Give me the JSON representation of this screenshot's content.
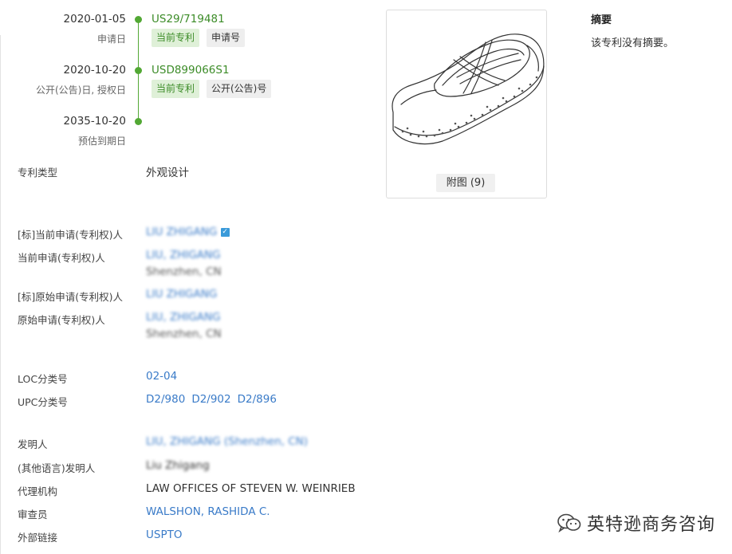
{
  "timeline": [
    {
      "date": "2020-01-05",
      "label": "申请日",
      "number": "US29/719481",
      "tags": [
        "当前专利",
        "申请号"
      ]
    },
    {
      "date": "2020-10-20",
      "label": "公开(公告)日, 授权日",
      "number": "USD899066S1",
      "tags": [
        "当前专利",
        "公开(公告)号"
      ]
    },
    {
      "date": "2035-10-20",
      "label": "预估到期日"
    }
  ],
  "figure": {
    "button_label": "附图 (9)"
  },
  "abstract": {
    "title": "摘要",
    "text": "该专利没有摘要。"
  },
  "fields": {
    "patent_type": {
      "label": "专利类型",
      "value": "外观设计"
    },
    "std_current_applicant": {
      "label": "[标]当前申请(专利权)人",
      "value": "LIU ZHIGANG"
    },
    "current_applicant": {
      "label": "当前申请(专利权)人",
      "value": "LIU, ZHIGANG",
      "location": "Shenzhen, CN"
    },
    "std_original_applicant": {
      "label": "[标]原始申请(专利权)人",
      "value": "LIU ZHIGANG"
    },
    "original_applicant": {
      "label": "原始申请(专利权)人",
      "value": "LIU, ZHIGANG",
      "location": "Shenzhen, CN"
    },
    "loc": {
      "label": "LOC分类号",
      "value": "02-04"
    },
    "upc": {
      "label": "UPC分类号",
      "values": [
        "D2/980",
        "D2/902",
        "D2/896"
      ]
    },
    "inventor": {
      "label": "发明人",
      "value": "LIU, ZHIGANG (Shenzhen, CN)"
    },
    "inventor_other": {
      "label": "(其他语言)发明人",
      "value": "Liu Zhigang"
    },
    "agency": {
      "label": "代理机构",
      "value": "LAW OFFICES OF STEVEN W. WEINRIEB"
    },
    "examiner": {
      "label": "审查员",
      "value": "WALSHON, RASHIDA C."
    },
    "external_link": {
      "label": "外部链接",
      "value": "USPTO"
    }
  },
  "watermark": {
    "text": "英特逊商务咨询"
  },
  "colors": {
    "green": "#52a834",
    "link": "#3a7bc8",
    "tag_green_bg": "#dff0d8"
  }
}
